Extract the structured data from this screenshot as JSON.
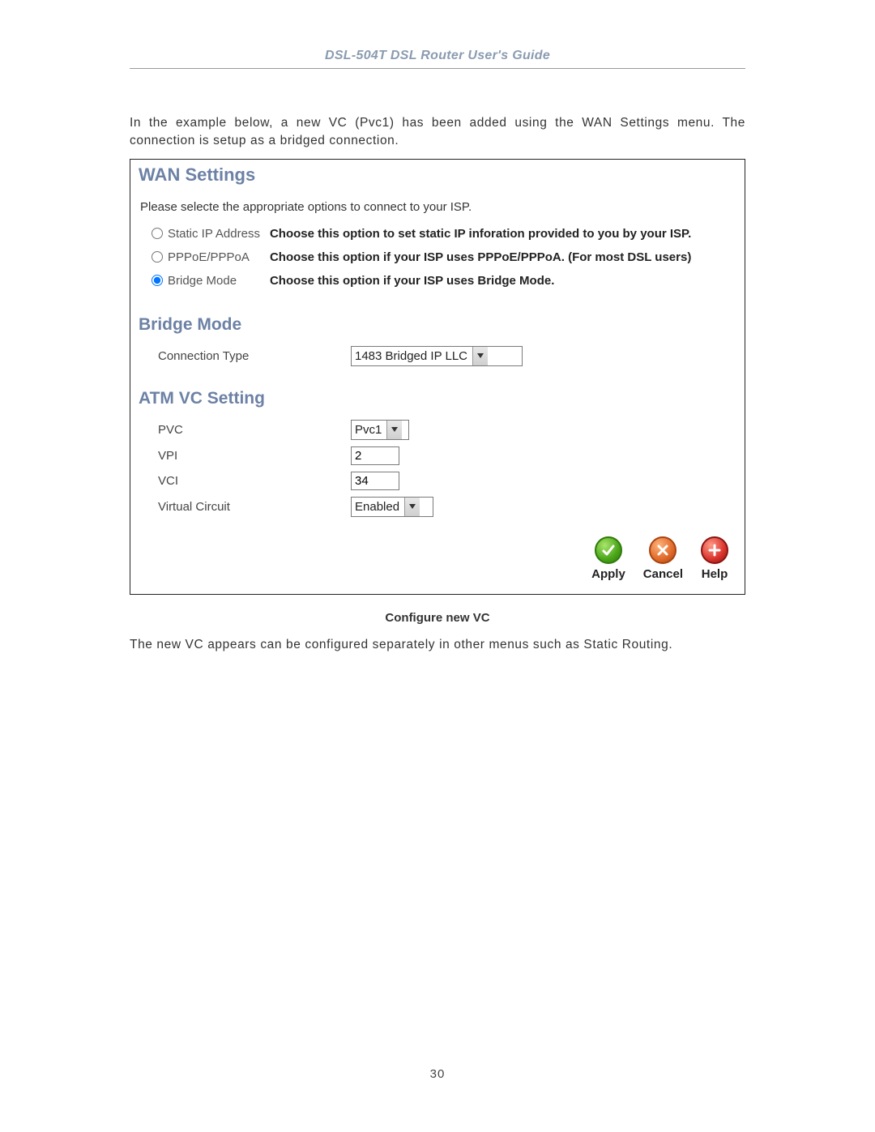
{
  "doc_header": "DSL-504T DSL Router User's Guide",
  "para1": "In the example below, a new VC (Pvc1) has been added using the WAN Settings menu. The connection is setup as a bridged connection.",
  "panel": {
    "title": "WAN Settings",
    "intro": "Please selecte the appropriate options to connect to your ISP.",
    "options": [
      {
        "label": "Static IP Address",
        "desc": "Choose this option to set static IP inforation provided to you by your ISP.",
        "checked": false
      },
      {
        "label": "PPPoE/PPPoA",
        "desc": "Choose this option if your ISP uses PPPoE/PPPoA. (For most DSL users)",
        "checked": false
      },
      {
        "label": "Bridge Mode",
        "desc": "Choose this option if your ISP uses Bridge Mode.",
        "checked": true
      }
    ],
    "bridge_title": "Bridge Mode",
    "bridge": {
      "conn_type_label": "Connection Type",
      "conn_type_value": "1483 Bridged IP LLC"
    },
    "atm_title": "ATM VC Setting",
    "atm": {
      "pvc_label": "PVC",
      "pvc_value": "Pvc1",
      "vpi_label": "VPI",
      "vpi_value": "2",
      "vci_label": "VCI",
      "vci_value": "34",
      "vc_label": "Virtual Circuit",
      "vc_value": "Enabled"
    },
    "actions": {
      "apply": "Apply",
      "cancel": "Cancel",
      "help": "Help"
    }
  },
  "caption": "Configure new VC",
  "para2": "The new VC appears can be configured separately in other menus such as Static Routing.",
  "page_number": "30"
}
